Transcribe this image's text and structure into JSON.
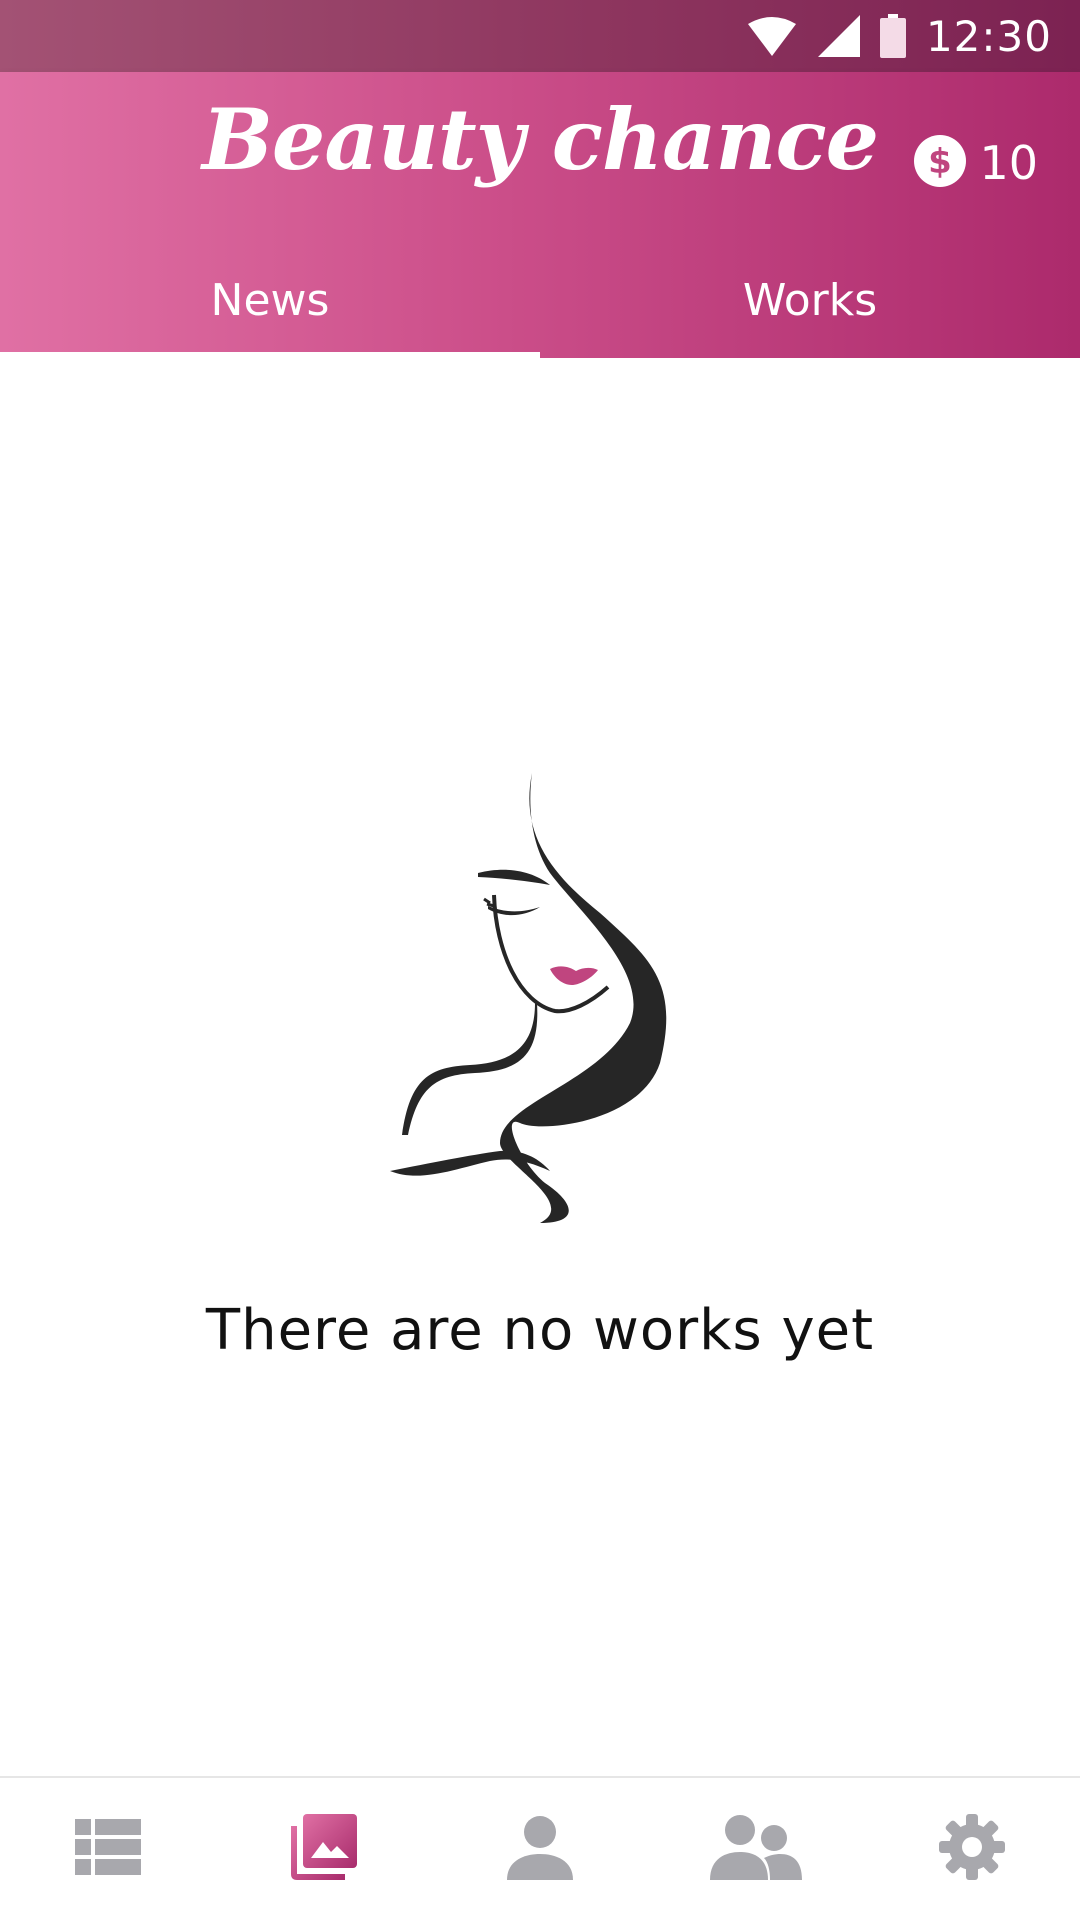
{
  "status_bar": {
    "time": "12:30",
    "icons": [
      "wifi-icon",
      "cellular-signal-icon",
      "battery-icon"
    ]
  },
  "app_bar": {
    "title": "Beauty chance",
    "coin_icon": "dollar-coin-icon",
    "coin_count": "10"
  },
  "tabs": [
    {
      "label": "News",
      "active": true
    },
    {
      "label": "Works",
      "active": false
    }
  ],
  "empty_state": {
    "illustration": "woman-face-illustration",
    "message": "There are no works yet"
  },
  "bottom_nav": {
    "items": [
      {
        "icon": "list-icon",
        "active": false
      },
      {
        "icon": "photo-library-icon",
        "active": true
      },
      {
        "icon": "person-icon",
        "active": false
      },
      {
        "icon": "people-icon",
        "active": false
      },
      {
        "icon": "settings-gear-icon",
        "active": false
      }
    ]
  },
  "colors": {
    "primary": "#cc4f8a",
    "primary_dark": "#7c2252",
    "inactive_icon": "#a8a8ad",
    "text": "#111111"
  }
}
